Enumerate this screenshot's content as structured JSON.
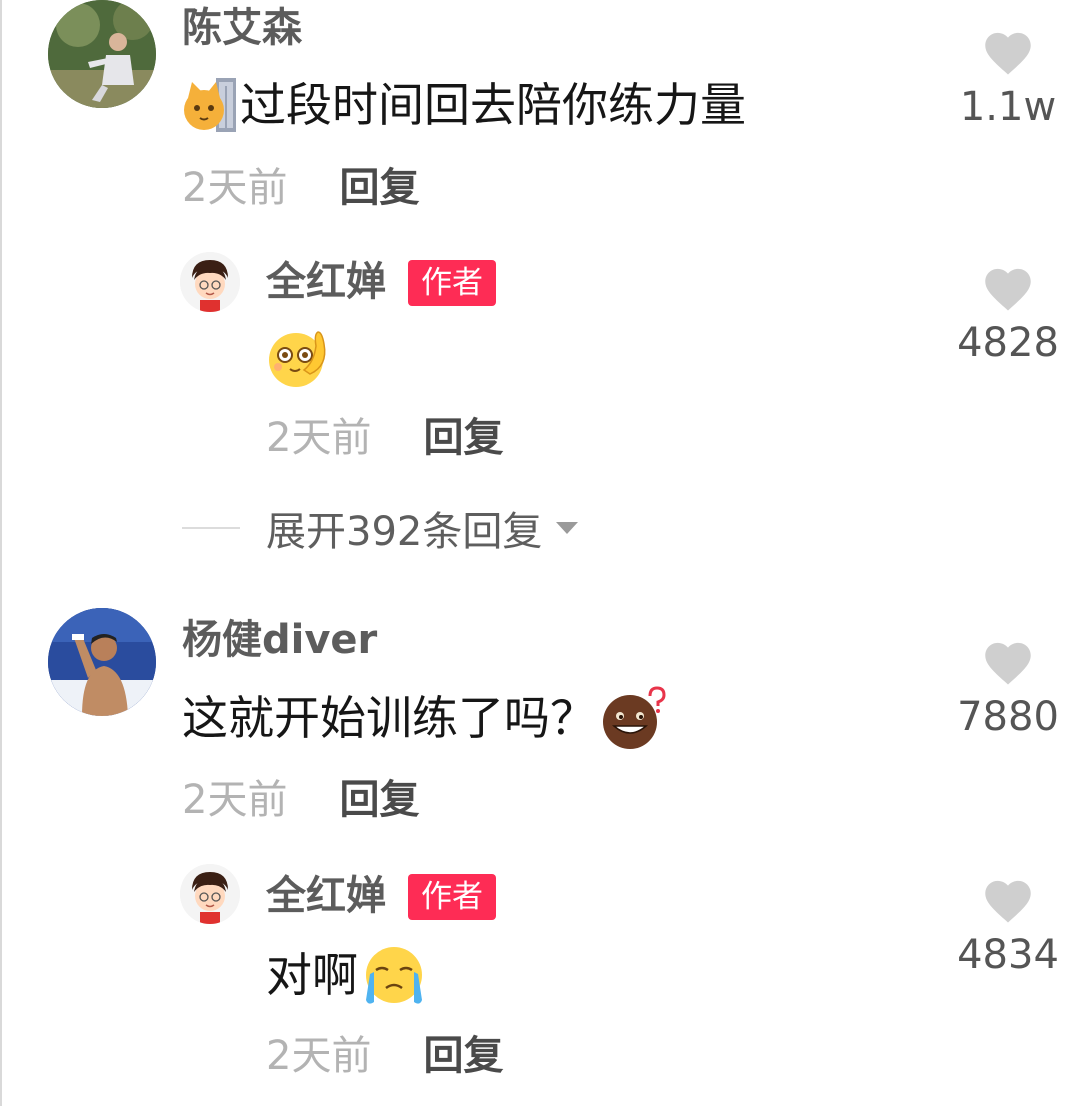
{
  "comments": [
    {
      "username": "陈艾森",
      "text": "过段时间回去陪你练力量",
      "time": "2天前",
      "reply_label": "回复",
      "like_count": "1.1w",
      "replies": [
        {
          "username": "全红婵",
          "badge": "作者",
          "text": "",
          "time": "2天前",
          "reply_label": "回复",
          "like_count": "4828"
        }
      ],
      "expand_label": "展开392条回复"
    },
    {
      "username": "杨健diver",
      "text": "这就开始训练了吗？",
      "time": "2天前",
      "reply_label": "回复",
      "like_count": "7880",
      "replies": [
        {
          "username": "全红婵",
          "badge": "作者",
          "text": "对啊",
          "time": "2天前",
          "reply_label": "回复",
          "like_count": "4834"
        }
      ]
    }
  ],
  "colors": {
    "badge": "#fe2c55",
    "username": "#5c5c5c",
    "content": "#161616",
    "time": "#b3b3b3",
    "like_icon": "#cfcfcf"
  },
  "icons": {
    "like": "heart-icon",
    "expand": "caret-down-icon",
    "emoji_1": "cat-peek-emoji",
    "emoji_2": "thinking-face-emoji",
    "emoji_3": "question-face-emoji",
    "emoji_4": "crying-face-emoji"
  }
}
